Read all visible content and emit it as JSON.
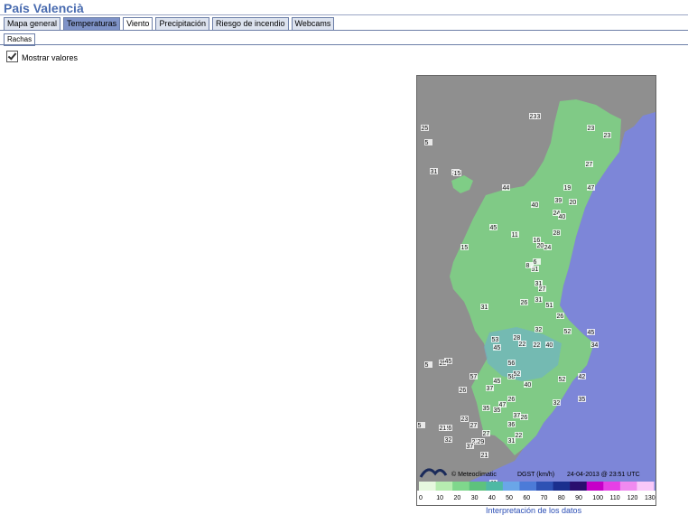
{
  "page": {
    "title": "País Valencià"
  },
  "tabs": [
    {
      "label": "Mapa general",
      "state": "normal"
    },
    {
      "label": "Temperaturas",
      "state": "highlight"
    },
    {
      "label": "Viento",
      "state": "active"
    },
    {
      "label": "Precipitación",
      "state": "normal"
    },
    {
      "label": "Riesgo de incendio",
      "state": "normal"
    },
    {
      "label": "Webcams",
      "state": "normal"
    }
  ],
  "subtabs": [
    {
      "label": "Rachas",
      "state": "active"
    }
  ],
  "options": {
    "show_values_label": "Mostrar valores",
    "show_values_checked": true
  },
  "map": {
    "credit": "© Meteoclimatic",
    "variable": "DGST (km/h)",
    "timestamp": "24-04-2013 @ 23:51 UTC",
    "colors": {
      "sea": "#7d86d8",
      "land": "#8f8f8f",
      "region": "#7fcd86"
    },
    "scale": {
      "ticks": [
        "0",
        "10",
        "20",
        "30",
        "40",
        "50",
        "60",
        "70",
        "80",
        "90",
        "100",
        "110",
        "120",
        "130"
      ],
      "colors": [
        "#e6f8df",
        "#b6ecb0",
        "#7fd78c",
        "#5ec27d",
        "#4fb9a4",
        "#6aa6e8",
        "#4c7bd8",
        "#2e52b4",
        "#1a2f8e",
        "#2a0f6e",
        "#c600c8",
        "#e640e6",
        "#f08af0",
        "#f9c8f9"
      ]
    },
    "stations": [
      "23",
      "25",
      "5",
      "16",
      "23",
      "23",
      "31",
      "15",
      "44",
      "19",
      "27",
      "23",
      "47",
      "39",
      "20",
      "40",
      "24",
      "45",
      "11",
      "40",
      "15",
      "16",
      "20",
      "24",
      "6",
      "31",
      "51",
      "28",
      "31",
      "8",
      "26",
      "27",
      "31",
      "26",
      "51",
      "28",
      "45",
      "22",
      "53",
      "32",
      "22",
      "40",
      "45",
      "34",
      "52",
      "45",
      "25",
      "56",
      "57",
      "52",
      "42",
      "5",
      "26",
      "58",
      "40",
      "37",
      "47",
      "35",
      "35",
      "52",
      "36",
      "26",
      "23",
      "22",
      "21",
      "31",
      "5",
      "29",
      "27",
      "37",
      "45",
      "35",
      "21",
      "27",
      "32",
      "37",
      "26",
      "26",
      "41",
      "21",
      "32"
    ]
  },
  "link": {
    "label": "Interpretación de los datos"
  }
}
